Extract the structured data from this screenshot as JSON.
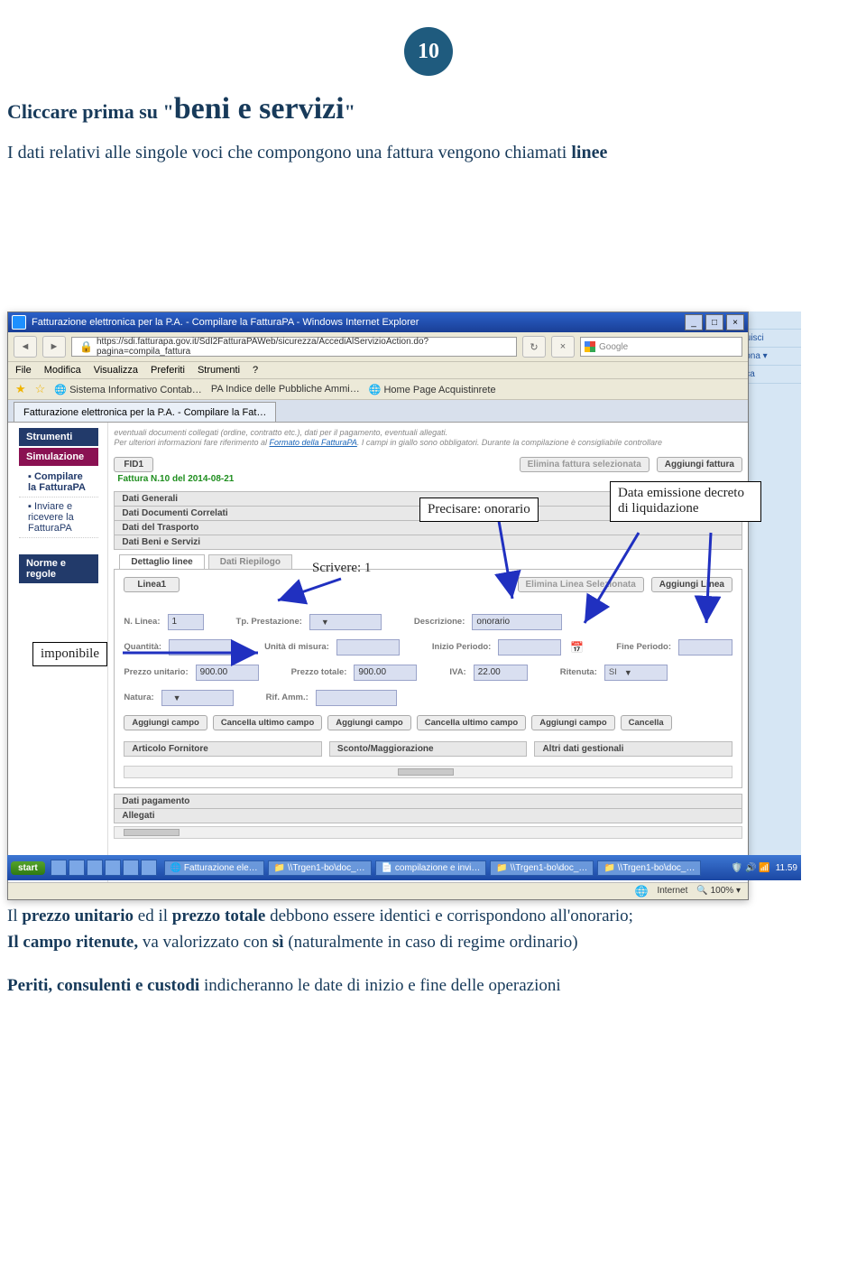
{
  "page_number": "10",
  "heading_prefix": "Cliccare prima su \"",
  "heading_big": "beni e servizi",
  "heading_suffix": "\"",
  "intro_pre": "I dati relativi alle singole voci che compongono una fattura vengono chiamati ",
  "intro_bold": "linee",
  "screenshot": {
    "window_title": "Fatturazione elettronica per la P.A. - Compilare la FatturaPA - Windows Internet Explorer",
    "url": "https://sdi.fatturapa.gov.it/SdI2FatturaPAWeb/sicurezza/AccediAlServizioAction.do?pagina=compila_fattura",
    "search_placeholder": "Google",
    "menu": [
      "File",
      "Modifica",
      "Visualizza",
      "Preferiti",
      "Strumenti",
      "?"
    ],
    "favorites": [
      "Sistema Informativo Contab…",
      "PA Indice delle Pubbliche Ammi…",
      "Home Page Acquistinrete"
    ],
    "tab": "Fatturazione elettronica per la P.A. - Compilare la Fat…",
    "sidebar": {
      "strumenti": "Strumenti",
      "simulazione": "Simulazione",
      "item_compilare": "Compilare la FatturaPA",
      "item_inviare": "Inviare e ricevere la FatturaPA",
      "norme": "Norme e regole"
    },
    "note1": "eventuali documenti collegati (ordine, contratto etc.), dati per il pagamento, eventuali allegati.",
    "note2_a": "Per ulteriori informazioni fare riferimento al ",
    "note2_link": "Formato della FatturaPA",
    "note2_b": ". I campi in giallo sono obbligatori. Durante la compilazione è consigliabile controllare",
    "fid_btn": "FID1",
    "elimina_fatt": "Elimina fattura selezionata",
    "aggiungi_fatt": "Aggiungi fattura",
    "fattura_num": "Fattura N.10 del 2014-08-21",
    "sections": {
      "generali": "Dati Generali",
      "documenti": "Dati Documenti Correlati",
      "trasporto": "Dati del Trasporto",
      "beni": "Dati Beni e Servizi"
    },
    "innertabs": {
      "dett": "Dettaglio linee",
      "riep": "Dati Riepilogo"
    },
    "linea_btn": "Linea1",
    "elimina_linea": "Elimina Linea Selezionata",
    "aggiungi_linea": "Aggiungi Linea",
    "fields": {
      "n_linea_lbl": "N. Linea:",
      "n_linea_val": "1",
      "tp_prest_lbl": "Tp. Prestazione:",
      "descr_lbl": "Descrizione:",
      "descr_val": "onorario",
      "quantita_lbl": "Quantità:",
      "unita_lbl": "Unità di misura:",
      "inizio_lbl": "Inizio Periodo:",
      "fine_lbl": "Fine Periodo:",
      "prezzo_u_lbl": "Prezzo unitario:",
      "prezzo_u_val": "900.00",
      "prezzo_t_lbl": "Prezzo totale:",
      "prezzo_t_val": "900.00",
      "iva_lbl": "IVA:",
      "iva_val": "22.00",
      "ritenuta_lbl": "Ritenuta:",
      "ritenuta_val": "SI",
      "natura_lbl": "Natura:",
      "rif_lbl": "Rif. Amm.:"
    },
    "btns": {
      "agg_campo": "Aggiungi campo",
      "canc_campo": "Cancella ultimo campo",
      "cancella": "Cancella"
    },
    "sub_art": "Articolo Fornitore",
    "sub_scon": "Sconto/Maggiorazione",
    "sub_altri": "Altri dati gestionali",
    "sec_pag": "Dati pagamento",
    "sec_alleg": "Allegati",
    "status": {
      "zone": "Internet",
      "zoom": "100%"
    }
  },
  "taskbar": {
    "start": "start",
    "tasks": [
      "Fatturazione ele…",
      "\\\\Trgen1-bo\\doc_…",
      "compilazione e invi…",
      "\\\\Trgen1-bo\\doc_…",
      "\\\\Trgen1-bo\\doc_…"
    ],
    "time": "11.59"
  },
  "callouts": {
    "precisare": "Precisare: onorario",
    "data_emissione": "Data emissione decreto di liquidazione",
    "scrivere": "Scrivere:  1",
    "imponibile": "imponibile"
  },
  "bottom": {
    "p1_a": "Il ",
    "p1_b": "prezzo unitario",
    "p1_c": " ed il ",
    "p1_d": "prezzo totale",
    "p1_e": " debbono essere identici e corrispondono all'onorario;",
    "p2_a": "Il campo ritenute,",
    "p2_b": " va valorizzato con ",
    "p2_c": "sì",
    "p2_d": "  (naturalmente in caso di regime ordinario)",
    "p3_a": "Periti, consulenti e custodi",
    "p3_b": " indicheranno le date di inizio e fine delle operazioni"
  }
}
